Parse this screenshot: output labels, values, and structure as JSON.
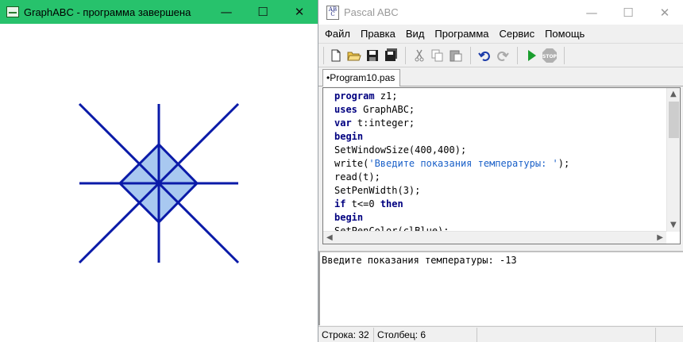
{
  "graph_window": {
    "title": "GraphABC - программа завершена",
    "title_bg": "#27c26c",
    "minimize": "—",
    "maximize": "☐",
    "close": "✕",
    "drawing": {
      "line_color": "#0a1aa8",
      "fill_color": "#a8c8f0",
      "shape": "star of 4 lines with a filled diamond at center"
    }
  },
  "pascal_window": {
    "logo": [
      "ABC"
    ],
    "title": "Pascal ABC",
    "minimize": "—",
    "maximize": "☐",
    "close": "✕",
    "menu": [
      "Файл",
      "Правка",
      "Вид",
      "Программа",
      "Сервис",
      "Помощь"
    ],
    "toolbar_icons": [
      "new-file-icon",
      "open-folder-icon",
      "save-icon",
      "save-all-icon",
      "cut-icon",
      "copy-icon",
      "paste-icon",
      "undo-icon",
      "redo-icon",
      "run-icon",
      "stop-icon"
    ],
    "tab": "•Program10.pas",
    "code_lines": [
      [
        {
          "t": "kw",
          "v": "program"
        },
        {
          "t": "tx",
          "v": " z1;"
        }
      ],
      [
        {
          "t": "kw",
          "v": "uses"
        },
        {
          "t": "tx",
          "v": " GraphABC;"
        }
      ],
      [
        {
          "t": "kw",
          "v": "var"
        },
        {
          "t": "tx",
          "v": " t:integer;"
        }
      ],
      [
        {
          "t": "kw",
          "v": "begin"
        }
      ],
      [
        {
          "t": "tx",
          "v": "SetWindowSize(400,400);"
        }
      ],
      [
        {
          "t": "tx",
          "v": "write("
        },
        {
          "t": "st",
          "v": "'Введите показания температуры: '"
        },
        {
          "t": "tx",
          "v": ");"
        }
      ],
      [
        {
          "t": "tx",
          "v": "read(t);"
        }
      ],
      [
        {
          "t": "tx",
          "v": "SetPenWidth(3);"
        }
      ],
      [
        {
          "t": "kw",
          "v": "if"
        },
        {
          "t": "tx",
          "v": " t<=0 "
        },
        {
          "t": "kw",
          "v": "then"
        }
      ],
      [
        {
          "t": "kw",
          "v": "begin"
        }
      ],
      [
        {
          "t": "tx",
          "v": "SetPenColor(clBlue);"
        }
      ]
    ],
    "output_text": "Введите показания температуры: -13",
    "status": {
      "line": "Строка: 32",
      "column": "Столбец: 6"
    }
  }
}
